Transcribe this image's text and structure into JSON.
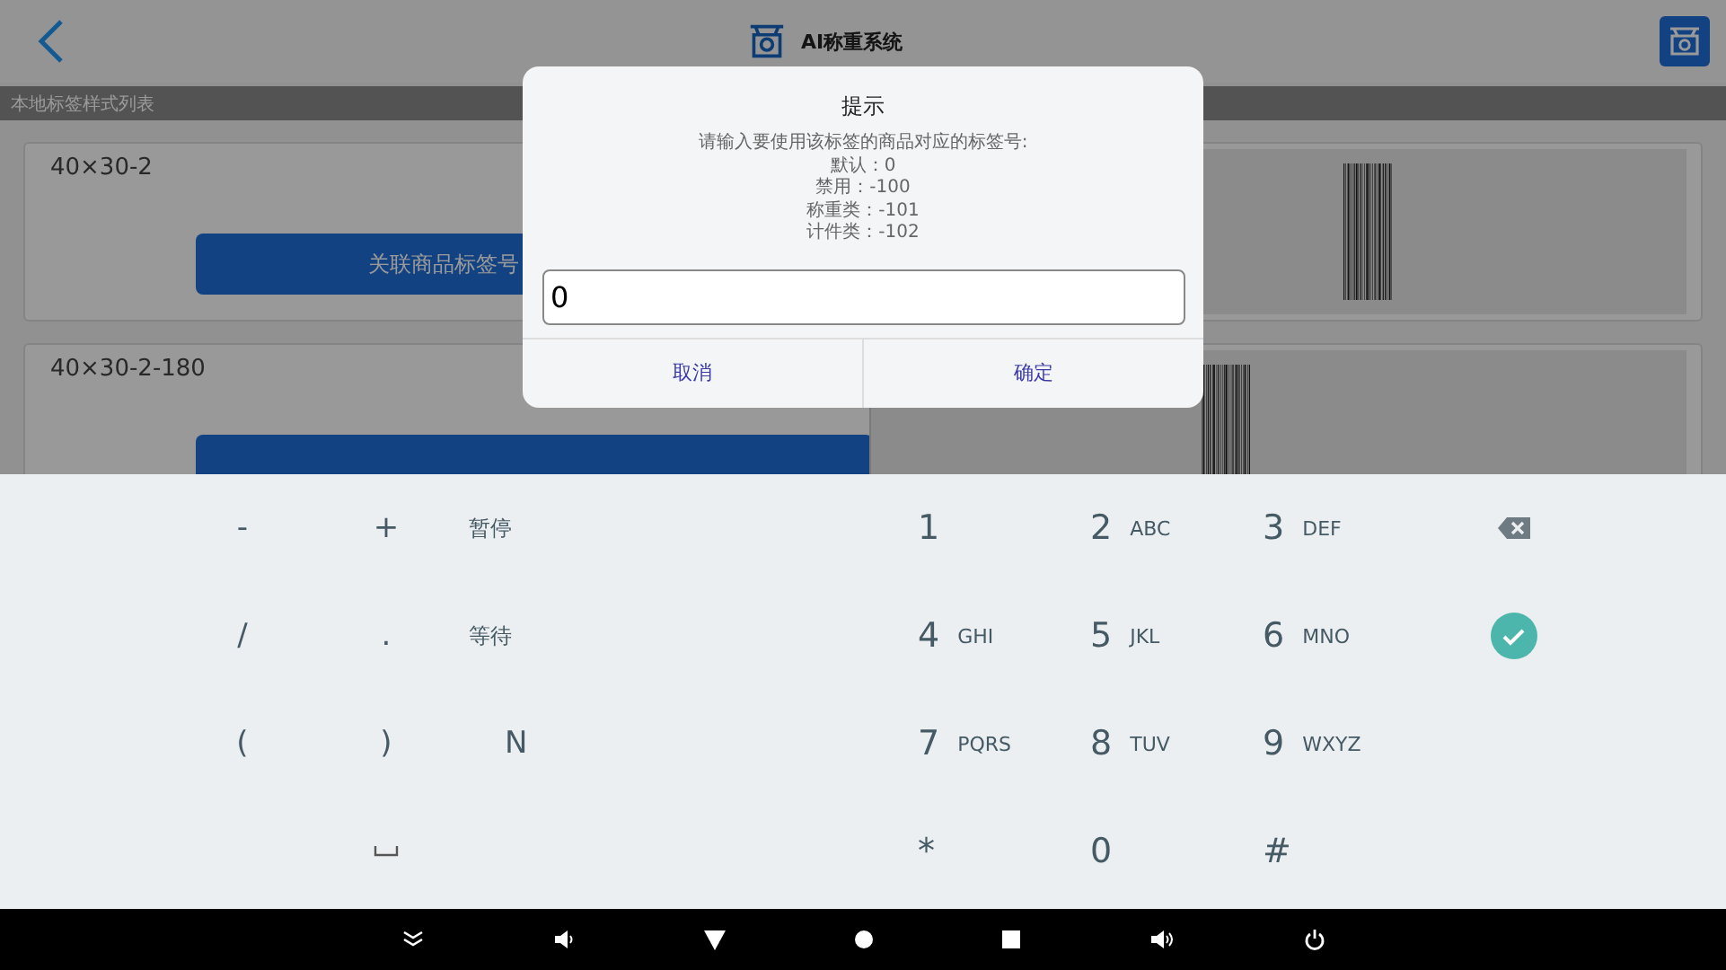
{
  "app_bar": {
    "title": "AI称重系统"
  },
  "section_header": "本地标签样式列表",
  "templates": [
    {
      "name": "40×30-2",
      "button": "关联商品标签号",
      "preview_rotated": false
    },
    {
      "name": "40×30-2-180",
      "preview_rotated": true
    }
  ],
  "dialog": {
    "title": "提示",
    "message": [
      "请输入要使用该标签的商品对应的标签号:",
      "默认：0",
      "禁用：-100",
      "称重类：-101",
      "计件类：-102"
    ],
    "value": "0",
    "buttons": [
      "取消",
      "确定"
    ]
  },
  "keyboard": {
    "left_keys": [
      {
        "kind": "key",
        "label": "-"
      },
      {
        "kind": "key",
        "label": "+"
      },
      {
        "kind": "word",
        "label": "暂停"
      },
      {
        "kind": "key",
        "label": "/"
      },
      {
        "kind": "key",
        "label": "."
      },
      {
        "kind": "word",
        "label": "等待"
      },
      {
        "kind": "key",
        "label": "("
      },
      {
        "kind": "key",
        "label": ")"
      },
      {
        "kind": "key",
        "label": "N"
      },
      {
        "kind": "blank"
      },
      {
        "kind": "space"
      },
      {
        "kind": "blank"
      }
    ],
    "right_keys": [
      {
        "kind": "digit",
        "digit": "1"
      },
      {
        "kind": "digit",
        "digit": "2",
        "letters": "ABC"
      },
      {
        "kind": "digit",
        "digit": "3",
        "letters": "DEF"
      },
      {
        "kind": "backspace"
      },
      {
        "kind": "digit",
        "digit": "4",
        "letters": "GHI"
      },
      {
        "kind": "digit",
        "digit": "5",
        "letters": "JKL"
      },
      {
        "kind": "digit",
        "digit": "6",
        "letters": "MNO"
      },
      {
        "kind": "done"
      },
      {
        "kind": "digit",
        "digit": "7",
        "letters": "PQRS"
      },
      {
        "kind": "digit",
        "digit": "8",
        "letters": "TUV"
      },
      {
        "kind": "digit",
        "digit": "9",
        "letters": "WXYZ"
      },
      {
        "kind": "blank"
      },
      {
        "kind": "digit",
        "digit": "*"
      },
      {
        "kind": "digit",
        "digit": "0"
      },
      {
        "kind": "digit",
        "digit": "#"
      },
      {
        "kind": "blank"
      }
    ]
  }
}
